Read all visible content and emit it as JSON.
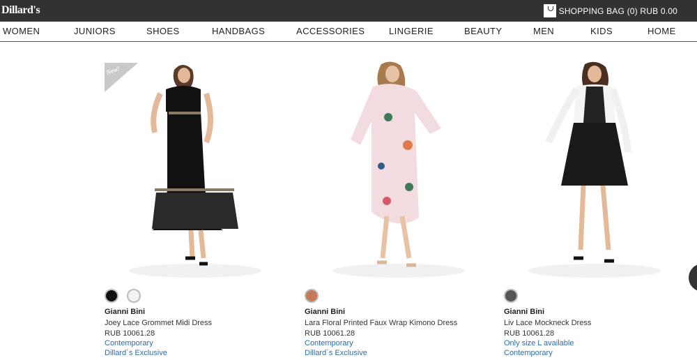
{
  "header": {
    "logo": "Dillard's",
    "bag_label": "SHOPPING BAG (0) RUB 0.00"
  },
  "nav": [
    "WOMEN",
    "JUNIORS",
    "SHOES",
    "HANDBAGS",
    "ACCESSORIES",
    "LINGERIE",
    "BEAUTY",
    "MEN",
    "KIDS",
    "HOME"
  ],
  "products": [
    {
      "badge": "New!",
      "brand": "Gianni Bini",
      "name": "Joey Lace Grommet Midi Dress",
      "price": "RUB 10061.28",
      "tag1": "Contemporary",
      "tag2": "Dillard´s Exclusive",
      "swatch_colors": [
        "#111111",
        "#f3f3f3"
      ]
    },
    {
      "brand": "Gianni Bini",
      "name": "Lara Floral Printed Faux Wrap Kimono Dress",
      "price": "RUB 10061.28",
      "tag1": "Contemporary",
      "tag2": "Dillard´s Exclusive",
      "swatch_colors": [
        "#c77a5a"
      ]
    },
    {
      "brand": "Gianni Bini",
      "name": "Liv Lace Mockneck Dress",
      "price": "RUB 10061.28",
      "tag1": "Only size L available",
      "tag2": "Contemporary",
      "swatch_colors": [
        "#555555"
      ]
    }
  ]
}
